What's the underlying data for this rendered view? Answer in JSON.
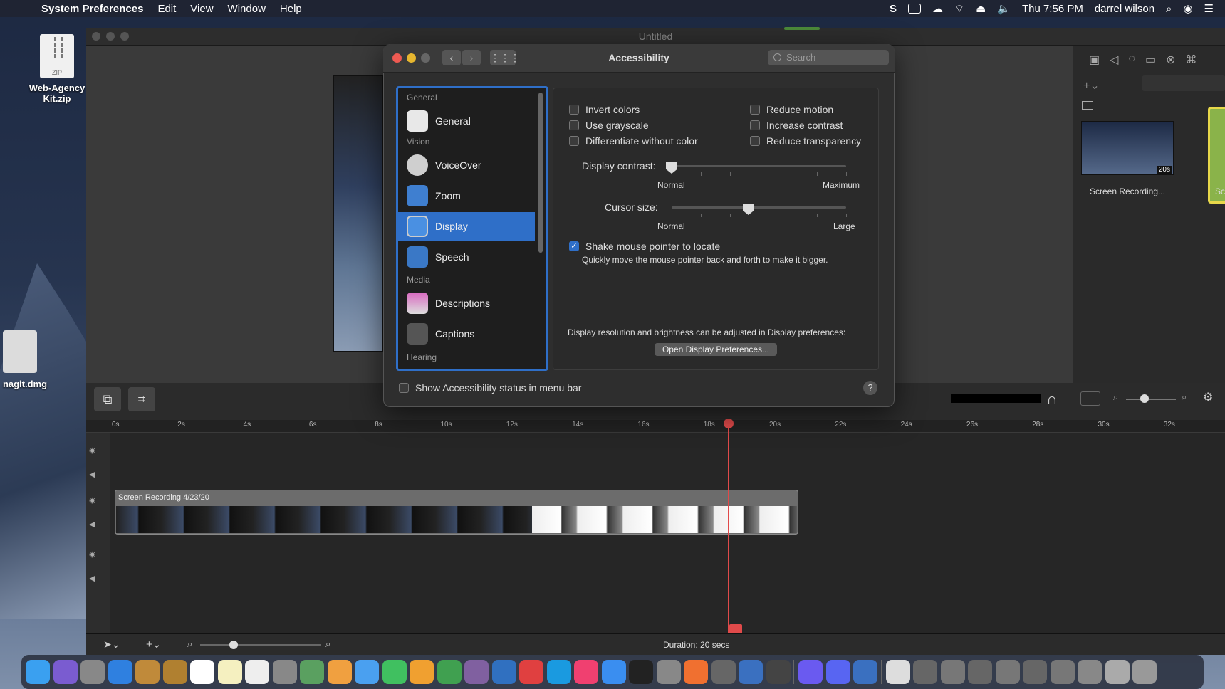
{
  "menubar": {
    "app": "System Preferences",
    "menus": [
      "Edit",
      "View",
      "Window",
      "Help"
    ],
    "clock": "Thu 7:56 PM",
    "user": "darrel wilson"
  },
  "desktop": {
    "icons": [
      {
        "label": "Web-Agency Kit.zip",
        "badge": "ZIP"
      },
      {
        "label": "nagit.dmg"
      }
    ]
  },
  "editor": {
    "window_title": "Untitled",
    "media_bin": {
      "thumb_label": "Screen Recording...",
      "thumb_duration": "20s",
      "thumb2_label": "Sc"
    },
    "ruler_ticks": [
      "0s",
      "2s",
      "4s",
      "6s",
      "8s",
      "10s",
      "12s",
      "14s",
      "16s",
      "18s",
      "20s",
      "22s",
      "24s",
      "26s",
      "28s",
      "30s",
      "32s"
    ],
    "clip_title": "Screen Recording 4/23/20",
    "duration": "Duration: 20 secs"
  },
  "dialog": {
    "title": "Accessibility",
    "search_placeholder": "Search",
    "sidebar": {
      "headers": {
        "general": "General",
        "vision": "Vision",
        "media": "Media",
        "hearing": "Hearing"
      },
      "items": [
        "General",
        "VoiceOver",
        "Zoom",
        "Display",
        "Speech",
        "Descriptions",
        "Captions"
      ],
      "selected": "Display"
    },
    "display": {
      "checkboxes_left": [
        "Invert colors",
        "Use grayscale",
        "Differentiate without color"
      ],
      "checkboxes_right": [
        "Reduce motion",
        "Increase contrast",
        "Reduce transparency"
      ],
      "contrast_label": "Display contrast:",
      "contrast_min": "Normal",
      "contrast_max": "Maximum",
      "contrast_level": 0,
      "cursor_label": "Cursor size:",
      "cursor_min": "Normal",
      "cursor_max": "Large",
      "cursor_level": 0.44,
      "shake_label": "Shake mouse pointer to locate",
      "shake_checked": true,
      "shake_desc": "Quickly move the mouse pointer back and forth to make it bigger.",
      "resolution_note": "Display resolution and brightness can be adjusted in Display preferences:",
      "open_button": "Open Display Preferences..."
    },
    "status_checkbox": "Show Accessibility status in menu bar",
    "help": "?"
  }
}
